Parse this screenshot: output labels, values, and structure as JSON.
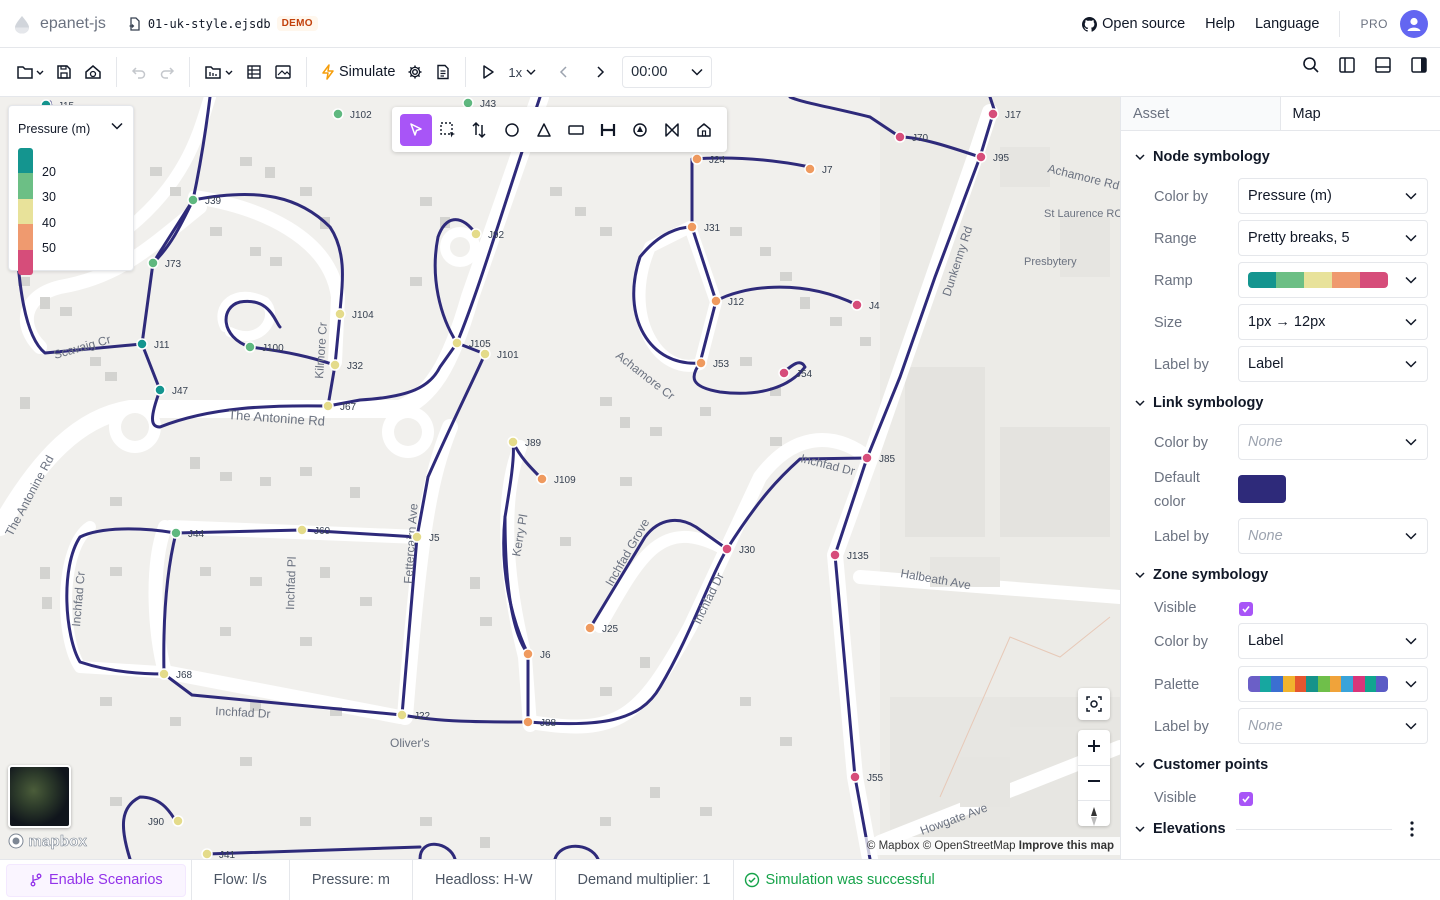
{
  "app": {
    "name": "epanet-js",
    "file_name": "01-uk-style.ejsdb",
    "badge": "DEMO"
  },
  "header": {
    "open_source": "Open source",
    "help": "Help",
    "language": "Language",
    "pro": "PRO"
  },
  "toolbar": {
    "simulate": "Simulate",
    "speed": "1x",
    "time": "00:00"
  },
  "legend": {
    "title": "Pressure (m)",
    "values": [
      "20",
      "30",
      "40",
      "50"
    ],
    "colors": [
      "#14958f",
      "#6cbf85",
      "#e8e29a",
      "#ef9a6f",
      "#d64d7a"
    ]
  },
  "map": {
    "node_colors": {
      "teal": "#14958f",
      "green": "#5fb87f",
      "yellow": "#e4db8a",
      "orange": "#ef9a5f",
      "pink": "#d64d7a"
    },
    "link_color": "#2e2a7a",
    "nodes": [
      {
        "id": "J15"
      },
      {
        "id": "J102"
      },
      {
        "id": "J43"
      },
      {
        "id": "J39"
      },
      {
        "id": "J73"
      },
      {
        "id": "J11"
      },
      {
        "id": "J47"
      },
      {
        "id": "J100"
      },
      {
        "id": "J104"
      },
      {
        "id": "J32"
      },
      {
        "id": "J67"
      },
      {
        "id": "J92"
      },
      {
        "id": "J105"
      },
      {
        "id": "J101"
      },
      {
        "id": "J24"
      },
      {
        "id": "J7"
      },
      {
        "id": "J31"
      },
      {
        "id": "J12"
      },
      {
        "id": "J4"
      },
      {
        "id": "J53"
      },
      {
        "id": "J54"
      },
      {
        "id": "J17"
      },
      {
        "id": "J70"
      },
      {
        "id": "J95"
      },
      {
        "id": "J89"
      },
      {
        "id": "J109"
      },
      {
        "id": "J85"
      },
      {
        "id": "J30"
      },
      {
        "id": "J135"
      },
      {
        "id": "J44"
      },
      {
        "id": "J60"
      },
      {
        "id": "J5"
      },
      {
        "id": "J25"
      },
      {
        "id": "J6"
      },
      {
        "id": "J68"
      },
      {
        "id": "J22"
      },
      {
        "id": "J88"
      },
      {
        "id": "J55"
      },
      {
        "id": "J90"
      },
      {
        "id": "J41"
      }
    ],
    "streets": [
      "Scavaig Cr",
      "The Antonine Rd",
      "Kilmore Cr",
      "Achamore Cr",
      "Achamore Rd",
      "St Laurence RC Catholic Church",
      "Presbytery",
      "Dunkenny Rd",
      "Inchfad Dr",
      "Halbeath Ave",
      "The Antonine Rd",
      "Inchfad Cr",
      "Inchfad Pl",
      "Fettercairn Ave",
      "Kerry Pl",
      "Inchfad Grove",
      "Inchfad Dr",
      "Inchfad Dr",
      "Oliver's",
      "Howgate Ave"
    ],
    "attribution": {
      "mapbox": "© Mapbox",
      "osm": "© OpenStreetMap",
      "improve": "Improve this map"
    },
    "logo": "mapbox"
  },
  "panel": {
    "tabs": [
      "Asset",
      "Map"
    ],
    "node_symbology": {
      "title": "Node symbology",
      "color_by_label": "Color by",
      "color_by": "Pressure (m)",
      "range_label": "Range",
      "range": "Pretty breaks, 5",
      "ramp_label": "Ramp",
      "ramp_colors": [
        "#14958f",
        "#6cbf85",
        "#e8e29a",
        "#ef9a6f",
        "#d64d7a"
      ],
      "size_label": "Size",
      "size": "1px → 12px",
      "label_by_label": "Label by",
      "label_by": "Label"
    },
    "link_symbology": {
      "title": "Link symbology",
      "color_by_label": "Color by",
      "color_by": "None",
      "default_label_1": "Default",
      "default_label_2": "color",
      "default_color": "#2e2a7a",
      "label_by_label": "Label by",
      "label_by": "None"
    },
    "zone_symbology": {
      "title": "Zone symbology",
      "visible_label": "Visible",
      "color_by_label": "Color by",
      "color_by": "Label",
      "palette_label": "Palette",
      "palette_colors": [
        "#6b5fc7",
        "#17a7a0",
        "#3b6fd1",
        "#f1b32e",
        "#e5562f",
        "#16938a",
        "#6fbf4a",
        "#f0a33a",
        "#3aa3d9",
        "#d8357a",
        "#10a58f",
        "#5a5bc5"
      ],
      "label_by_label": "Label by",
      "label_by": "None"
    },
    "customer_points": {
      "title": "Customer points",
      "visible_label": "Visible"
    },
    "elevations": {
      "title": "Elevations"
    }
  },
  "statusbar": {
    "scenarios": "Enable Scenarios",
    "flow": "Flow: l/s",
    "pressure": "Pressure: m",
    "headloss": "Headloss: H-W",
    "demand": "Demand multiplier: 1",
    "status": "Simulation was successful"
  }
}
